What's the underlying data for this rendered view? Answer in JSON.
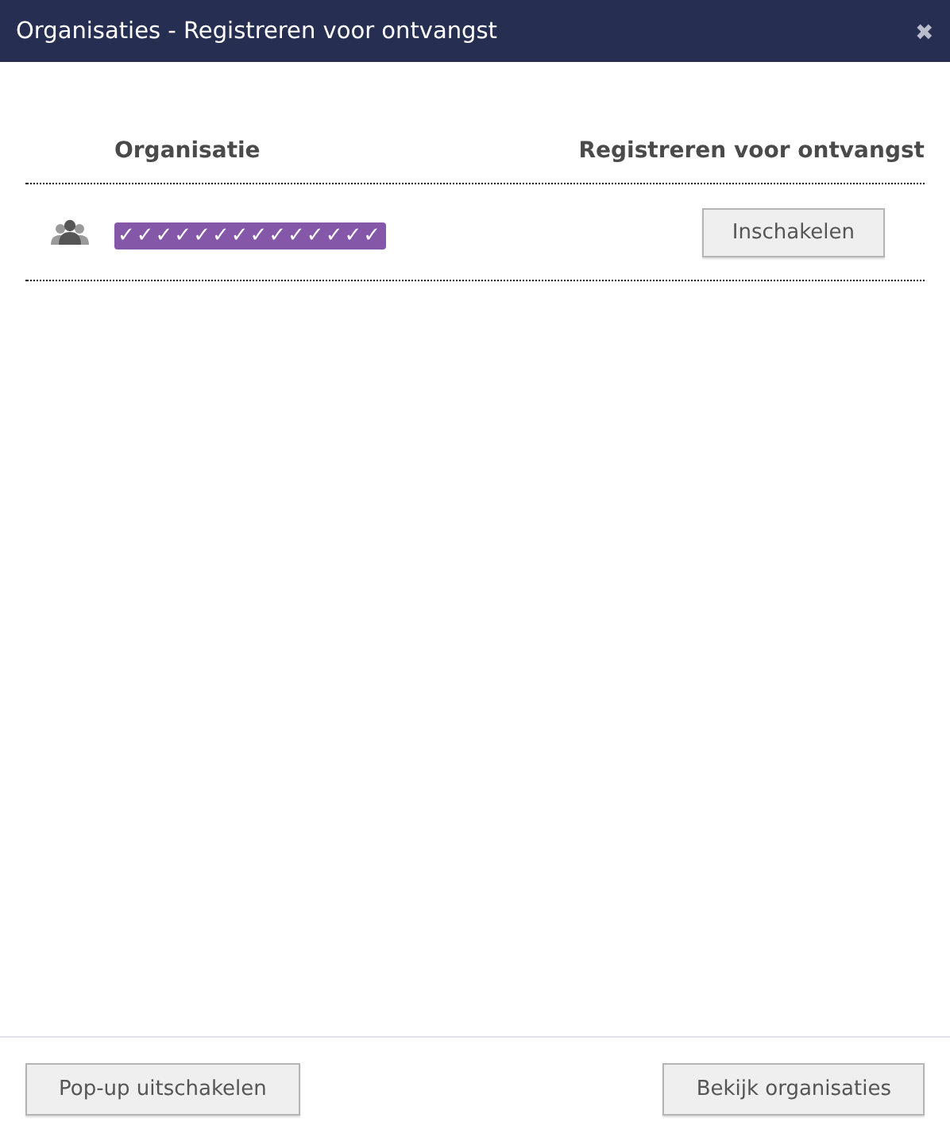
{
  "window": {
    "title": "Organisaties - Registreren voor ontvangst",
    "close": "✖"
  },
  "table": {
    "columns": [
      "Organisatie",
      "Registreren voor ontvangst"
    ],
    "rows": [
      {
        "name": "✓✓✓✓✓✓✓✓✓✓✓✓✓✓",
        "action": "Inschakelen"
      }
    ]
  },
  "buttons": [
    "Pop-up uitschakelen",
    "Bekijk organisaties"
  ]
}
